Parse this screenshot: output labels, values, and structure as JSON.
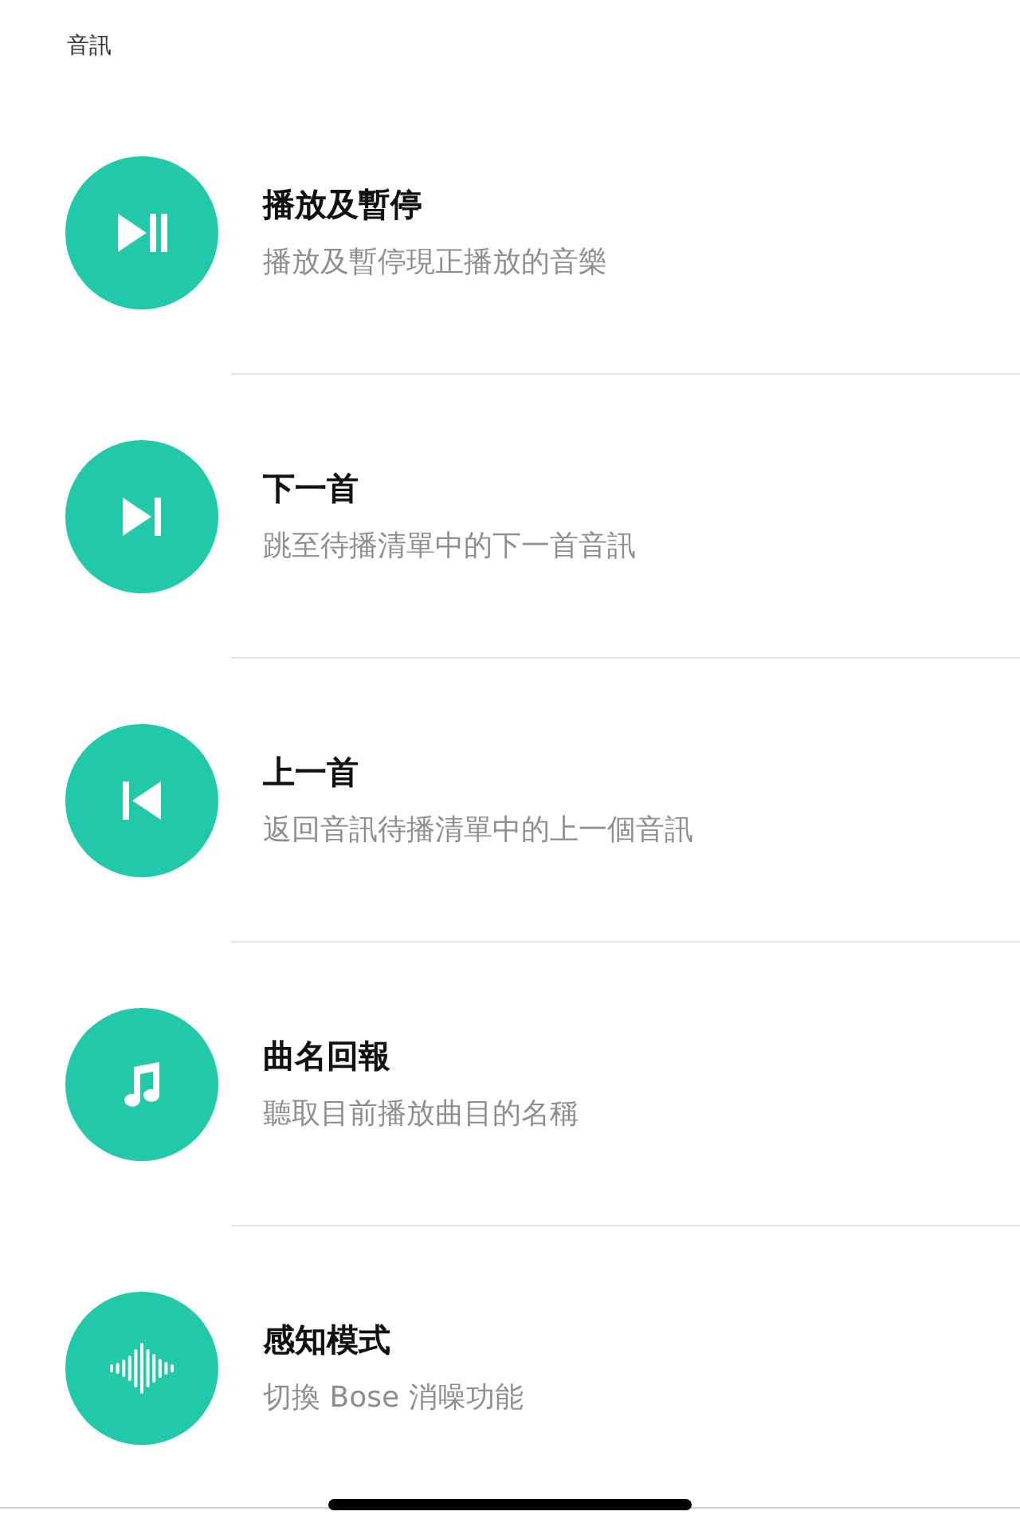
{
  "section_title": "音訊",
  "items": [
    {
      "kind": "play-pause",
      "title": "播放及暫停",
      "subtitle": "播放及暫停現正播放的音樂"
    },
    {
      "kind": "next",
      "title": "下一首",
      "subtitle": "跳至待播清單中的下一首音訊"
    },
    {
      "kind": "previous",
      "title": "上一首",
      "subtitle": "返回音訊待播清單中的上一個音訊"
    },
    {
      "kind": "music",
      "title": "曲名回報",
      "subtitle": "聽取目前播放曲目的名稱"
    },
    {
      "kind": "wave",
      "title": "感知模式",
      "subtitle": "切換 Bose 消噪功能"
    }
  ]
}
